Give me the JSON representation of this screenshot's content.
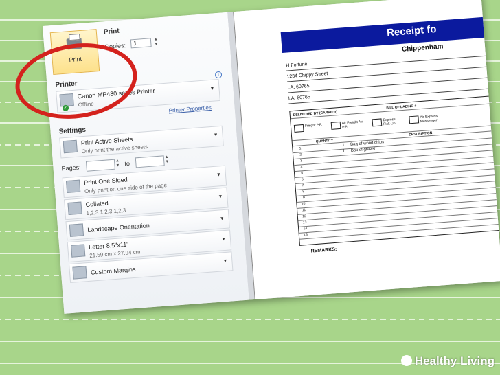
{
  "print": {
    "button_label": "Print",
    "section_title": "Print",
    "copies_label": "Copies:",
    "copies_value": "1"
  },
  "printer": {
    "section_title": "Printer",
    "name": "Canon MP480 series Printer",
    "status": "Offline",
    "properties_link": "Printer Properties"
  },
  "settings": {
    "section_title": "Settings",
    "items": [
      {
        "title": "Print Active Sheets",
        "subtitle": "Only print the active sheets"
      },
      {
        "title": "Print One Sided",
        "subtitle": "Only print on one side of the page"
      },
      {
        "title": "Collated",
        "subtitle": "1,2,3    1,2,3    1,2,3"
      },
      {
        "title": "Landscape Orientation",
        "subtitle": ""
      },
      {
        "title": "Letter 8.5\"x11\"",
        "subtitle": "21.59 cm x 27.94 cm"
      },
      {
        "title": "Custom Margins",
        "subtitle": ""
      }
    ],
    "pages_label": "Pages:",
    "to_label": "to"
  },
  "receipt": {
    "title": "Receipt fo",
    "subtitle": "Chippenham",
    "name": "H Fortune",
    "address": "1234 Chippy Street",
    "city": "LA, 60765",
    "zip": "LA, 60765",
    "delivered_by": "DELIVERED BY (CARRIER)",
    "bill_of_lading": "BILL OF LADING #",
    "options": [
      "Freight P.P.",
      "Air Freight Air P.P.",
      "Express Pick-Up",
      "Air Express Messenger"
    ],
    "quantity_header": "QUANTITY",
    "description_header": "DESCRIPTION",
    "line_items": [
      {
        "qty": "1",
        "desc": "Bag of wood chips"
      },
      {
        "qty": "1",
        "desc": "Box of gravel"
      }
    ],
    "row_numbers": [
      "1",
      "2",
      "3",
      "4",
      "5",
      "6",
      "7",
      "8",
      "9",
      "10",
      "11",
      "12",
      "13",
      "14",
      "15"
    ],
    "remarks": "REMARKS:"
  },
  "watermark": {
    "text": "Healthy Living"
  },
  "colors": {
    "background": "#a8d58a",
    "banner": "#0b1a9e",
    "circle": "#d4221d",
    "print_button": "#fde18c"
  }
}
